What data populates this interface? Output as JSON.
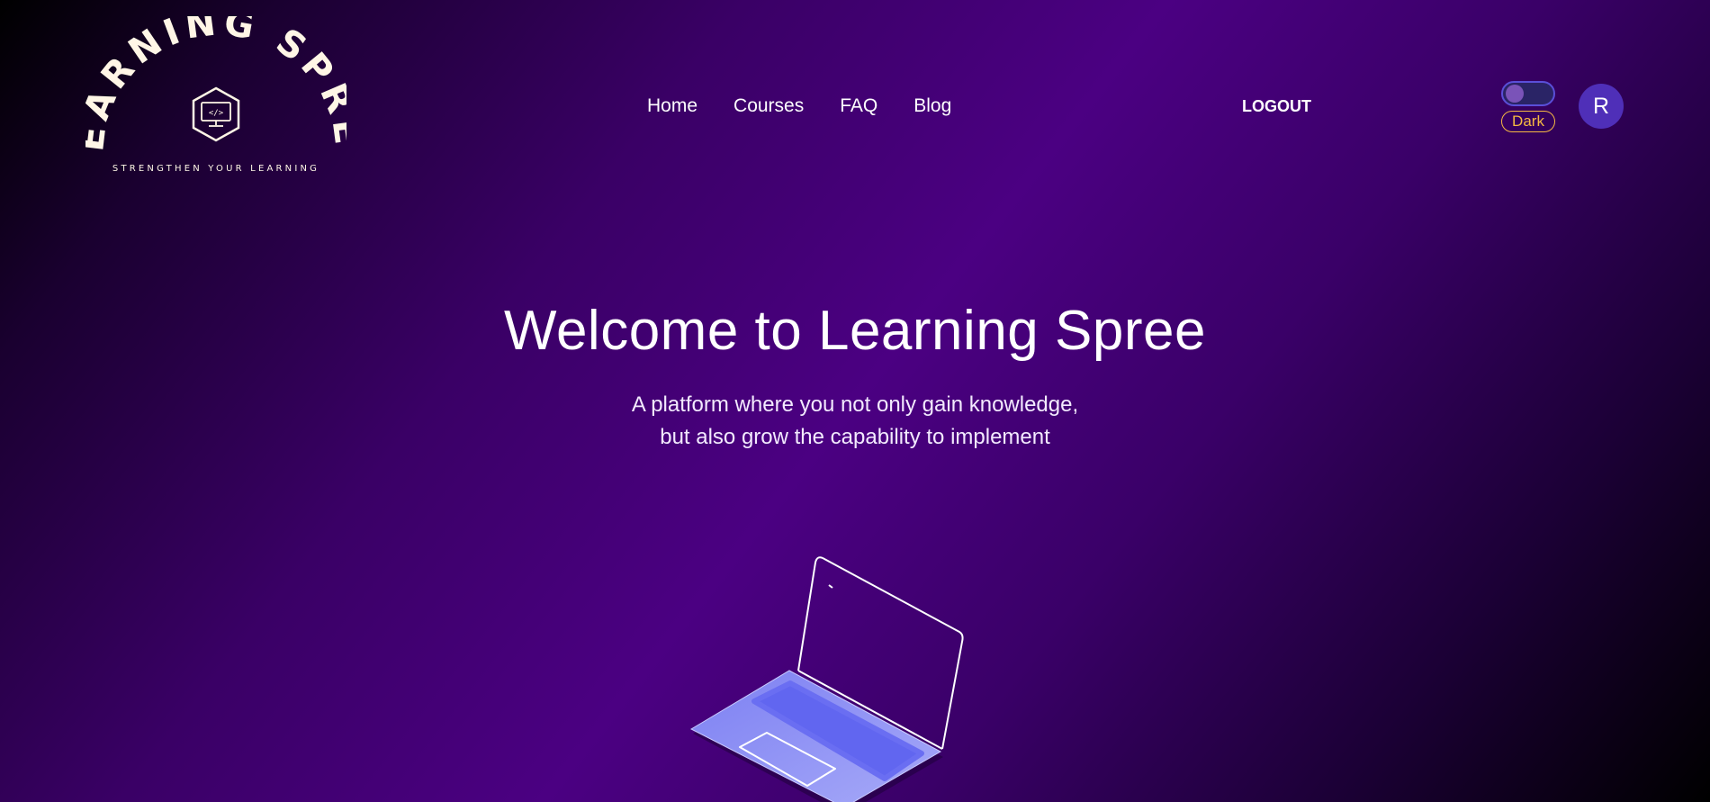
{
  "brand": {
    "name": "LEARNING SPREE",
    "tagline": "STRENGTHEN YOUR LEARNING",
    "emblem": "</>"
  },
  "nav": {
    "items": [
      {
        "label": "Home"
      },
      {
        "label": "Courses"
      },
      {
        "label": "FAQ"
      },
      {
        "label": "Blog"
      }
    ]
  },
  "header": {
    "logout_label": "LOGOUT",
    "theme_label": "Dark",
    "theme_toggle_on": true,
    "avatar_initial": "R"
  },
  "hero": {
    "title": "Welcome to Learning Spree",
    "subtitle_line1": "A platform where you not only gain knowledge,",
    "subtitle_line2": "but also grow the capability to implement"
  },
  "colors": {
    "background_mid": "#4b0082",
    "accent_gold": "#f5b942",
    "avatar_bg": "#4f2fb8",
    "laptop_base": "#8b8ff5",
    "laptop_keyboard": "#6166f0",
    "logo_cream": "#fff6e6"
  },
  "icons": {
    "logo_emblem": "monitor-code-icon",
    "hero_illustration": "laptop-illustration"
  }
}
